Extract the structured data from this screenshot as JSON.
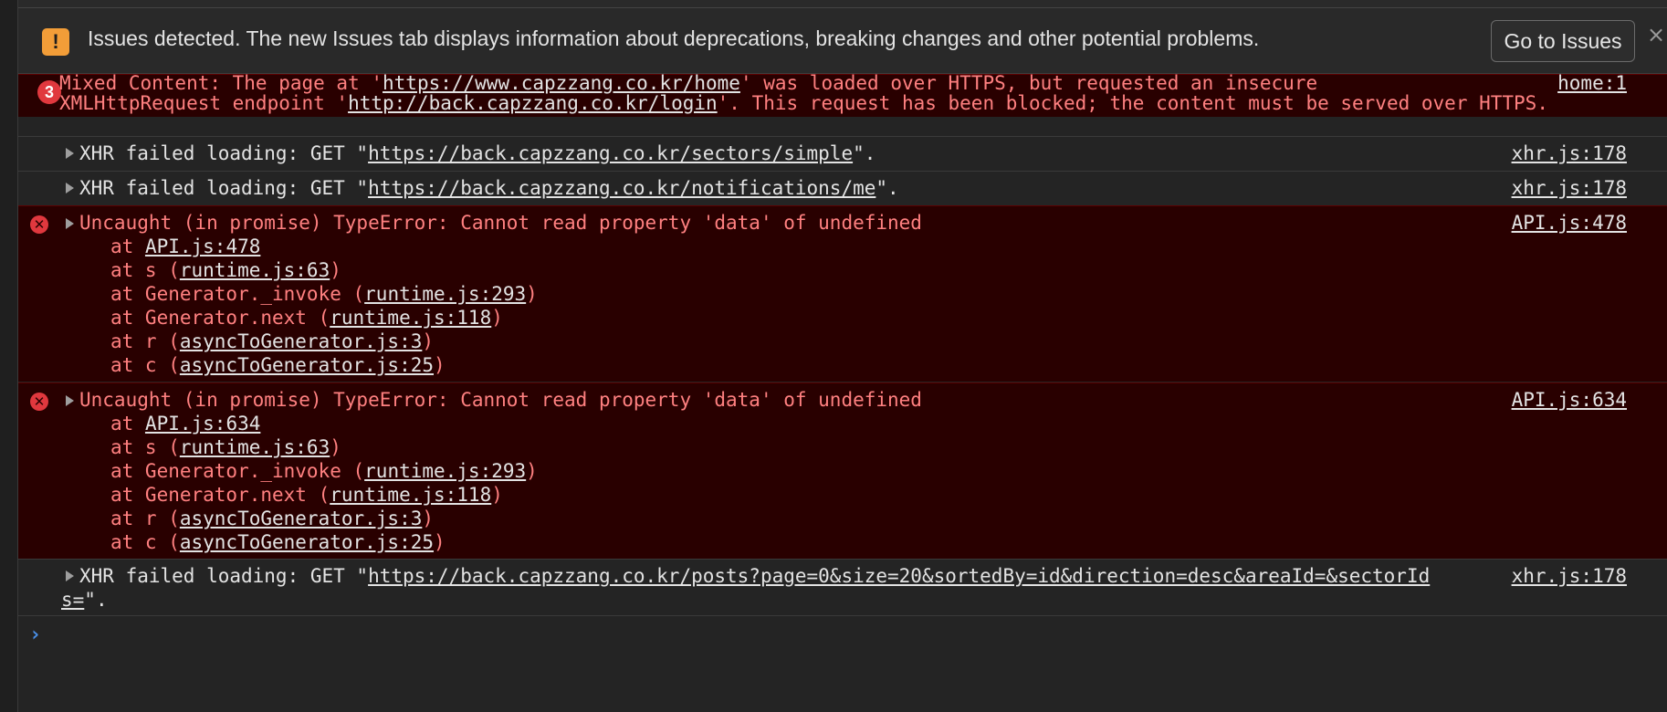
{
  "issues_bar": {
    "icon": "warning-icon",
    "icon_glyph": "!",
    "text": "Issues detected. The new Issues tab displays information about deprecations, breaking changes and other potential problems.",
    "button_label": "Go to Issues",
    "close_glyph": "×"
  },
  "messages": {
    "mixed": {
      "count": "3",
      "line1_a": "Mixed Content: The page at '",
      "line1_link": "https://www.capzzang.co.kr/home",
      "line1_b": "' was loaded over HTTPS, but requested an insecure",
      "line2_a": "XMLHttpRequest endpoint '",
      "line2_link": "http://back.capzzang.co.kr/login",
      "line2_b": "'. This request has been blocked; the content must be served over HTTPS.",
      "source": "home:1"
    },
    "xhr1": {
      "prefix": "XHR failed loading: GET \"",
      "url": "https://back.capzzang.co.kr/sectors/simple",
      "suffix": "\".",
      "source": "xhr.js:178"
    },
    "xhr2": {
      "prefix": "XHR failed loading: GET \"",
      "url": "https://back.capzzang.co.kr/notifications/me",
      "suffix": "\".",
      "source": "xhr.js:178"
    },
    "err1": {
      "icon_glyph": "✕",
      "text": "Uncaught (in promise) TypeError: Cannot read property 'data' of undefined",
      "source": "API.js:478",
      "stack": [
        {
          "pre": "at ",
          "name": "",
          "link": "API.js:478",
          "post": ""
        },
        {
          "pre": "at s (",
          "name": "",
          "link": "runtime.js:63",
          "post": ")"
        },
        {
          "pre": "at Generator._invoke (",
          "name": "",
          "link": "runtime.js:293",
          "post": ")"
        },
        {
          "pre": "at Generator.next (",
          "name": "",
          "link": "runtime.js:118",
          "post": ")"
        },
        {
          "pre": "at r (",
          "name": "",
          "link": "asyncToGenerator.js:3",
          "post": ")"
        },
        {
          "pre": "at c (",
          "name": "",
          "link": "asyncToGenerator.js:25",
          "post": ")"
        }
      ]
    },
    "err2": {
      "icon_glyph": "✕",
      "text": "Uncaught (in promise) TypeError: Cannot read property 'data' of undefined",
      "source": "API.js:634",
      "stack": [
        {
          "pre": "at ",
          "name": "",
          "link": "API.js:634",
          "post": ""
        },
        {
          "pre": "at s (",
          "name": "",
          "link": "runtime.js:63",
          "post": ")"
        },
        {
          "pre": "at Generator._invoke (",
          "name": "",
          "link": "runtime.js:293",
          "post": ")"
        },
        {
          "pre": "at Generator.next (",
          "name": "",
          "link": "runtime.js:118",
          "post": ")"
        },
        {
          "pre": "at r (",
          "name": "",
          "link": "asyncToGenerator.js:3",
          "post": ")"
        },
        {
          "pre": "at c (",
          "name": "",
          "link": "asyncToGenerator.js:25",
          "post": ")"
        }
      ]
    },
    "xhr3": {
      "prefix": "XHR failed loading: GET \"",
      "url_line1": "https://back.capzzang.co.kr/posts?page=0&size=20&sortedBy=id&direction=desc&areaId=&sectorId",
      "url_line2": "s=",
      "suffix": "\".",
      "source": "xhr.js:178"
    }
  },
  "prompt": {
    "caret": "›",
    "value": ""
  },
  "colors": {
    "error_bg": "#290000",
    "error_text": "#ff8080",
    "warning_accent": "#f29d38",
    "prompt_caret": "#4a90e8"
  }
}
